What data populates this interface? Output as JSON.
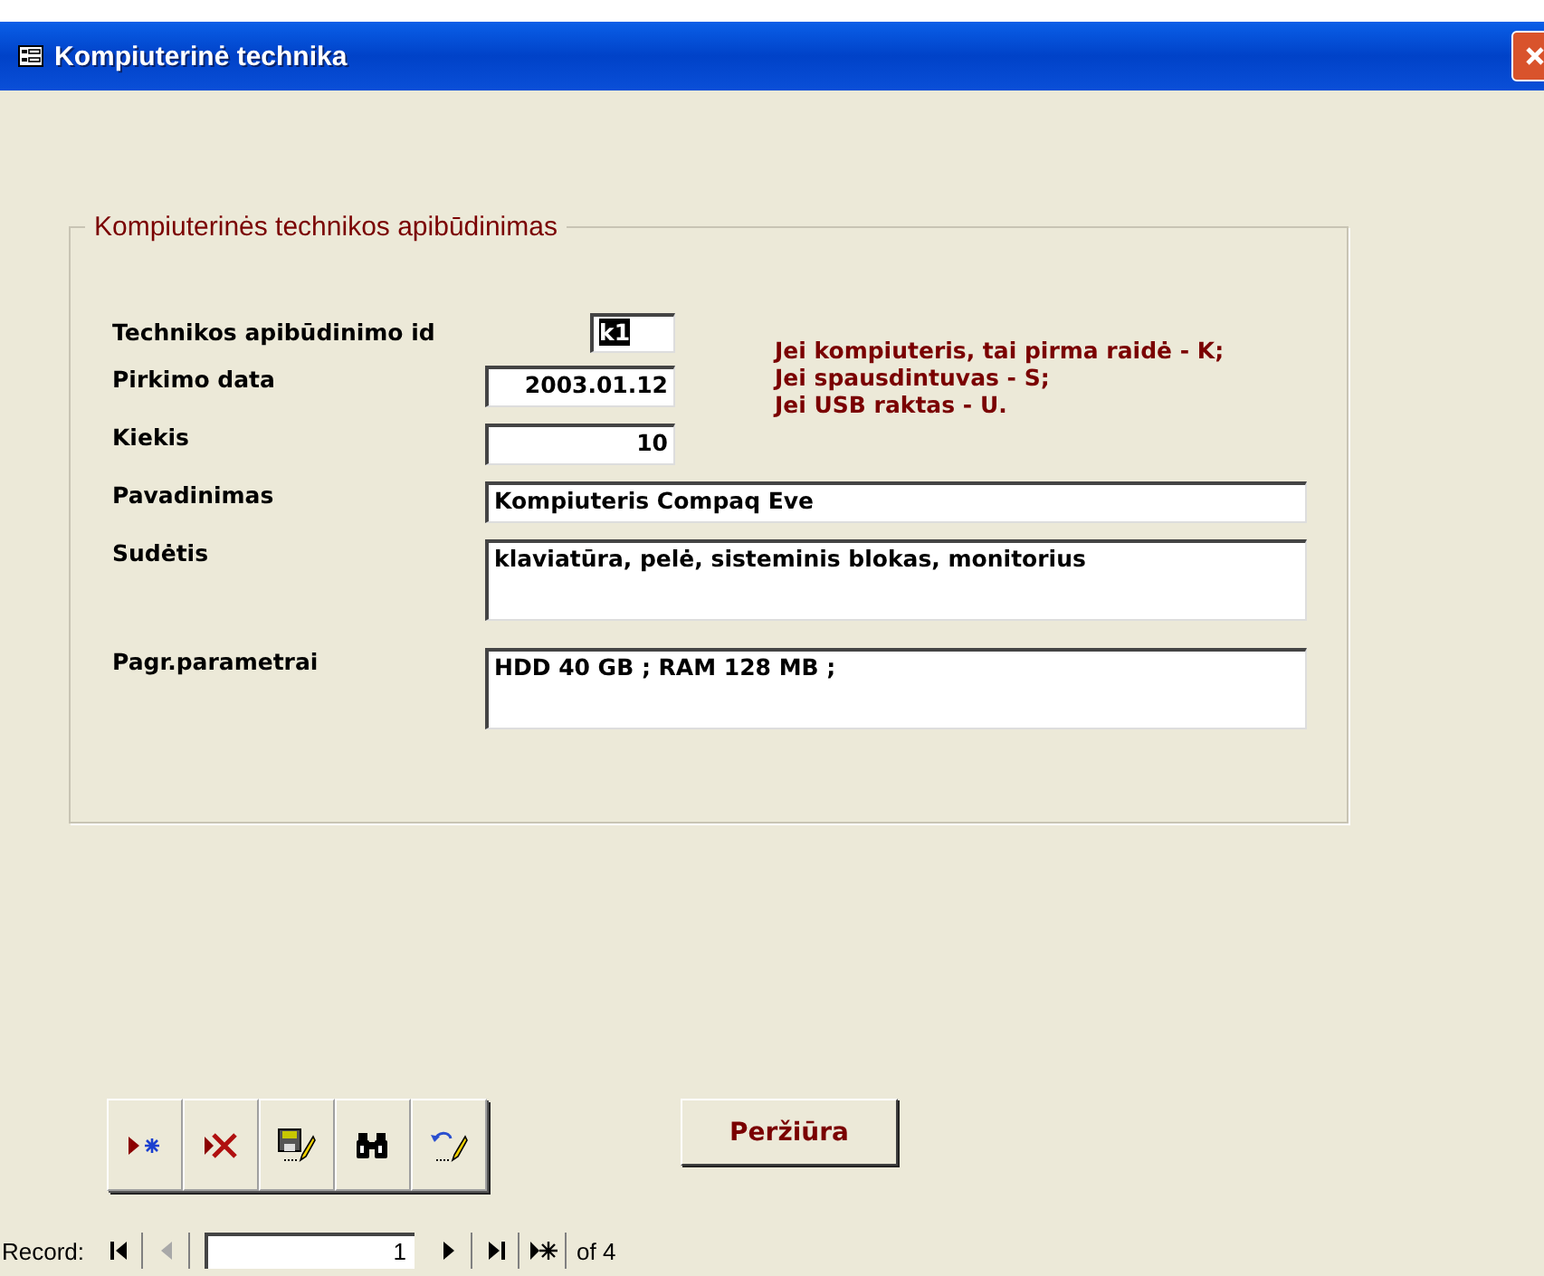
{
  "window": {
    "title": "Kompiuterinė technika"
  },
  "group": {
    "legend": "Kompiuterinės technikos apibūdinimas",
    "fields": [
      {
        "label": "Technikos apibūdinimo id",
        "value": "k1",
        "kind": "short",
        "selected": true
      },
      {
        "label": "Pirkimo data",
        "value": "2003.01.12",
        "kind": "number",
        "selected": false
      },
      {
        "label": "Kiekis",
        "value": "10",
        "kind": "number",
        "selected": false
      },
      {
        "label": "Pavadinimas",
        "value": "Kompiuteris Compaq Eve",
        "kind": "wide",
        "selected": false
      },
      {
        "label": "Sudėtis",
        "value": "klaviatūra, pelė, sisteminis blokas, monitorius",
        "kind": "memo",
        "selected": false
      },
      {
        "label": "Pagr.parametrai",
        "value": "HDD 40 GB ; RAM 128 MB ;",
        "kind": "memo",
        "selected": false
      }
    ],
    "hint": [
      "Jei kompiuteris, tai pirma raidė - K;",
      "Jei spausdintuvas - S;",
      "Jei USB raktas - U."
    ]
  },
  "toolbar": [
    {
      "kind": "new"
    },
    {
      "kind": "delete"
    },
    {
      "kind": "save"
    },
    {
      "kind": "find"
    },
    {
      "kind": "undo"
    }
  ],
  "preview_button": "Peržiūra",
  "navigator": {
    "label": "Record:",
    "current": "1",
    "total": "of 4",
    "buttons": [
      {
        "kind": "first",
        "disabled": false
      },
      {
        "kind": "prev",
        "disabled": true
      },
      {
        "kind": "field"
      },
      {
        "kind": "next",
        "disabled": false
      },
      {
        "kind": "last",
        "disabled": false
      },
      {
        "kind": "new",
        "disabled": false
      }
    ]
  }
}
